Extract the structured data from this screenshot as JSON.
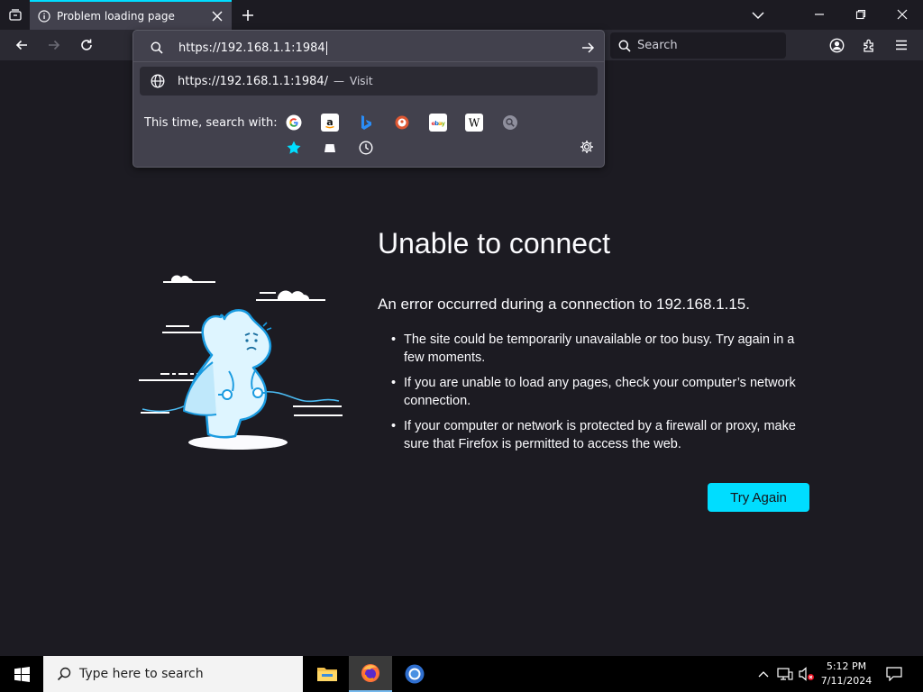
{
  "browser": {
    "tab": {
      "title": "Problem loading page"
    },
    "urlbar": {
      "value": "https://192.168.1.1:1984",
      "suggestion_url": "https://192.168.1.1:1984/",
      "suggestion_dash": "—",
      "suggestion_action": "Visit",
      "search_with_label": "This time, search with:",
      "engines": [
        "google",
        "amazon",
        "bing",
        "duckduckgo",
        "ebay",
        "wikipedia",
        "search",
        "bookmarks",
        "tabs",
        "history"
      ]
    },
    "search_box": {
      "placeholder": "Search"
    }
  },
  "error_page": {
    "title": "Unable to connect",
    "subtitle": "An error occurred during a connection to 192.168.1.15.",
    "bullets": [
      "The site could be temporarily unavailable or too busy. Try again in a few moments.",
      "If you are unable to load any pages, check your computer’s network connection.",
      "If your computer or network is protected by a firewall or proxy, make sure that Firefox is permitted to access the web."
    ],
    "try_again_label": "Try Again"
  },
  "taskbar": {
    "search_placeholder": "Type here to search",
    "time": "5:12 PM",
    "date": "7/11/2024"
  },
  "colors": {
    "accent": "#00ddff",
    "page_bg": "#1c1b22",
    "toolbar_bg": "#2b2a33",
    "panel_bg": "#42414d"
  }
}
